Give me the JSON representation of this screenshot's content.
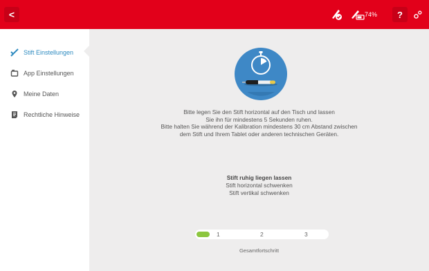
{
  "header": {
    "back_label": "<",
    "battery_percent": "74%",
    "help_label": "?",
    "icons": [
      "pen-connected-icon",
      "pen-battery-icon",
      "settings-icon"
    ]
  },
  "sidebar": {
    "items": [
      {
        "label": "Stift Einstellungen",
        "icon": "pen-icon",
        "active": true
      },
      {
        "label": "App Einstellungen",
        "icon": "tablet-icon",
        "active": false
      },
      {
        "label": "Meine Daten",
        "icon": "location-pin-icon",
        "active": false
      },
      {
        "label": "Rechtliche Hinweise",
        "icon": "document-icon",
        "active": false
      }
    ]
  },
  "main": {
    "instructions": [
      "Bitte legen Sie den Stift horizontal auf den Tisch und lassen",
      "Sie ihn für mindestens 5 Sekunden ruhen.",
      "Bitte halten Sie während der Kalibration mindestens 30 cm Abstand zwischen",
      "dem Stift und Ihrem Tablet oder anderen technischen Geräten."
    ],
    "steps": [
      {
        "label": "Stift ruhig liegen lassen",
        "current": true
      },
      {
        "label": "Stift horizontal schwenken",
        "current": false
      },
      {
        "label": "Stift vertikal schwenken",
        "current": false
      }
    ],
    "progress": {
      "step_numbers": [
        "1",
        "2",
        "3"
      ],
      "fraction": 0.1,
      "label": "Gesamtfortschritt"
    }
  },
  "colors": {
    "brand_red": "#e2001a",
    "accent_blue": "#2e8bc0",
    "progress_green": "#8cc63f",
    "content_bg": "#eeeded"
  }
}
